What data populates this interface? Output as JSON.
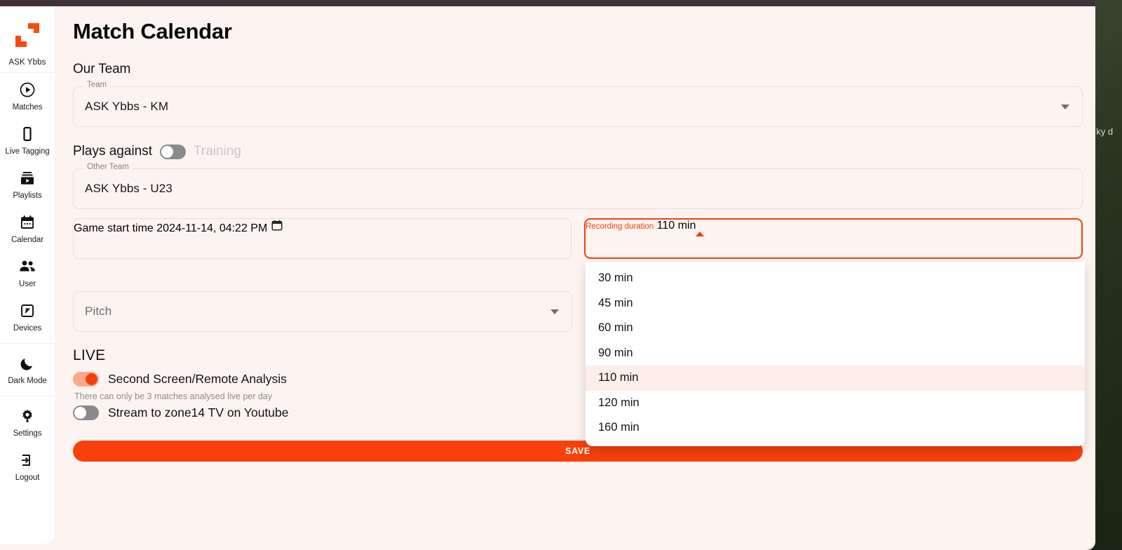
{
  "window": {
    "titlebar_color": "#41323a",
    "app_background": "#fdf4f1",
    "accent_color": "#f3400b"
  },
  "desktop": {
    "edge_text": "nt e ky d"
  },
  "sidebar": {
    "brand_label": "ASK Ybbs",
    "items": [
      {
        "icon": "play-circle-icon",
        "label": "Matches"
      },
      {
        "icon": "mobile-phone-icon",
        "label": "Live Tagging"
      },
      {
        "icon": "playlist-video-icon",
        "label": "Playlists"
      },
      {
        "icon": "calendar-icon",
        "label": "Calendar"
      },
      {
        "icon": "people-icon",
        "label": "User"
      },
      {
        "icon": "devices-icon",
        "label": "Devices"
      },
      {
        "icon": "moon-icon",
        "label": "Dark Mode"
      },
      {
        "icon": "gear-icon",
        "label": "Settings"
      },
      {
        "icon": "logout-icon",
        "label": "Logout"
      }
    ]
  },
  "main": {
    "page_title": "Match Calendar",
    "our_team_heading": "Our Team",
    "team_field": {
      "legend": "Team",
      "value": "ASK Ybbs - KM"
    },
    "plays_against": {
      "label": "Plays against",
      "toggle_state": "off",
      "training_label": "Training"
    },
    "other_team_field": {
      "legend": "Other Team",
      "value": "ASK Ybbs - U23"
    },
    "game_start_field": {
      "legend": "Game start time",
      "value": "2024-11-14, 04:22 PM",
      "icon": "calendar-picker-icon"
    },
    "recording_duration_field": {
      "legend": "Recording duration",
      "value": "110 min",
      "expanded": true,
      "options": [
        "30 min",
        "45 min",
        "60 min",
        "90 min",
        "110 min",
        "120 min",
        "160 min"
      ],
      "selected_option": "110 min"
    },
    "pitch_field": {
      "placeholder": "Pitch",
      "value": ""
    },
    "live": {
      "heading": "LIVE",
      "second_screen": {
        "label": "Second Screen/Remote Analysis",
        "toggle_state": "on"
      },
      "hint": "There can only be 3 matches analysed live per day",
      "stream_youtube": {
        "label": "Stream to zone14 TV on Youtube",
        "toggle_state": "off"
      }
    },
    "save_label": "SAVE"
  }
}
